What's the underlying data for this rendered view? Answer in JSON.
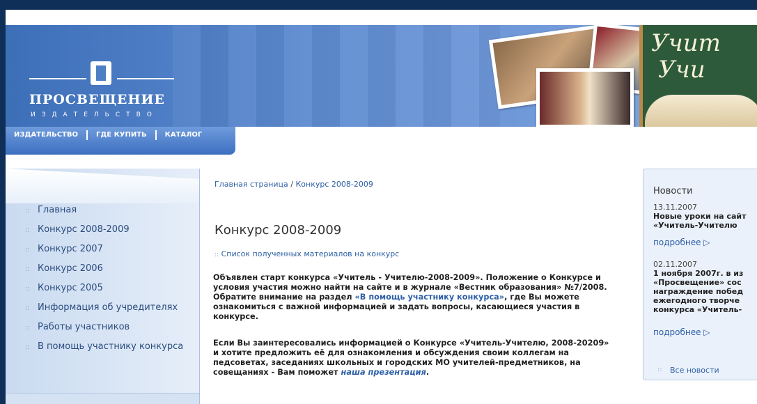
{
  "logo": {
    "title": "ПРОСВЕЩЕНИЕ",
    "subtitle": "ИЗДАТЕЛЬСТВО"
  },
  "banner": {
    "board_line1": "Учит",
    "board_line2": "Учи"
  },
  "nav": [
    "ИЗДАТЕЛЬСТВО",
    "ГДЕ КУПИТЬ",
    "КАТАЛОГ"
  ],
  "sidebar": {
    "bullet": "::",
    "items": [
      {
        "label": "Главная"
      },
      {
        "label": "Конкурс 2008-2009"
      },
      {
        "label": "Конкурс 2007"
      },
      {
        "label": "Конкурс 2006"
      },
      {
        "label": "Конкурс 2005"
      },
      {
        "label": "Информация об учредителях"
      },
      {
        "label": "Работы участников"
      },
      {
        "label": "В помощь участнику конкурса"
      }
    ]
  },
  "breadcrumb": {
    "home": "Главная страница",
    "sep": " / ",
    "current": "Конкурс 2008-2009"
  },
  "main": {
    "title": "Конкурс 2008-2009",
    "sublink": "Список полученных материалов на конкурс",
    "p1_a": "Объявлен старт конкурса «Учитель - Учителю-2008-2009». Положение о Конкурсе и условия участия можно найти на сайте  и в журнале «Вестник образования» №7/2008. Обратите внимание на раздел ",
    "p1_link": "«В помощь участнику конкурса»",
    "p1_b": ", где Вы можете ознакомиться с важной информацией и задать вопросы, касающиеся участия в конкурсе.",
    "p2_a": "Если Вы заинтересовались информацией о Конкурсе «Учитель-Учителю, 2008-20209» и хотите предложить её для ознакомления и обсуждения своим коллегам на педсоветах, заседаниях школьных и городских МО учителей-предметников, на совещаниях - Вам поможет ",
    "p2_link": "наша презентация",
    "p2_b": "."
  },
  "news": {
    "title": "Новости",
    "items": [
      {
        "date": "13.11.2007",
        "text": "Новые уроки на сайт «Учитель-Учителю",
        "more": "подробнее ▷"
      },
      {
        "date": "02.11.2007",
        "text": "1 ноября 2007г. в из «Просвещение» сос награждение побед ежегодного творче конкурса «Учитель-",
        "more": "подробнее ▷"
      }
    ],
    "all": "Все новости"
  },
  "colors": {
    "link": "#2d5fa6",
    "frame": "#0f2e58",
    "banner": "#5c8ad0"
  }
}
